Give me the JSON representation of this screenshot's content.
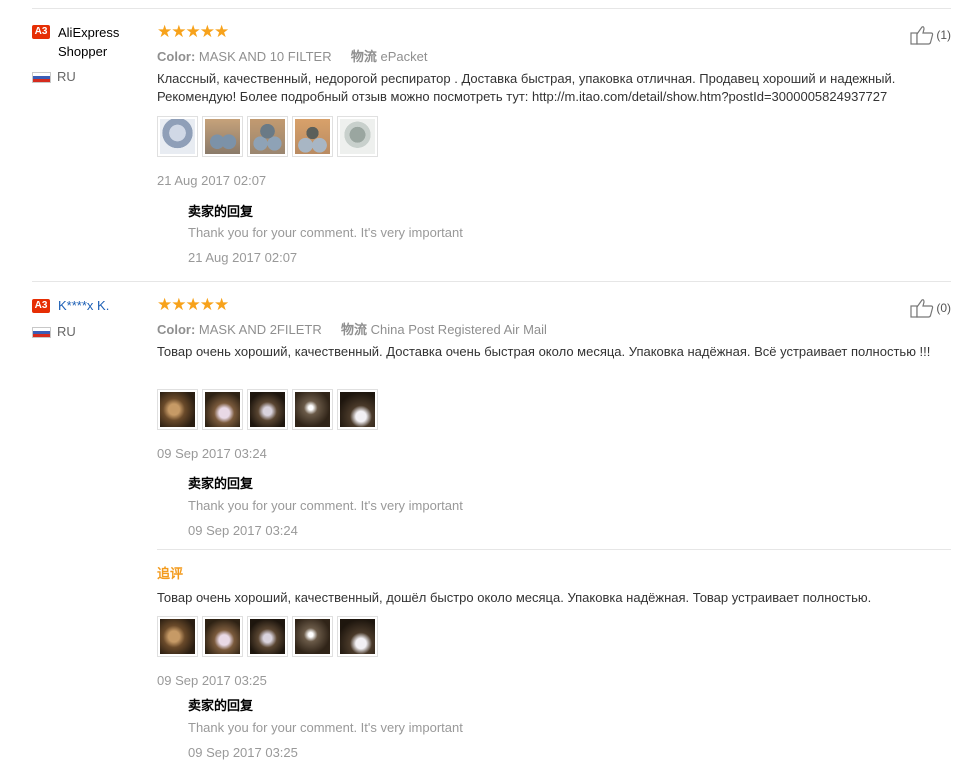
{
  "reviews": [
    {
      "badge": "A3",
      "user": "AliExpress Shopper",
      "country": "RU",
      "stars": "★★★★★",
      "color_label": "Color:",
      "color_value": "MASK AND 10 FILTER",
      "shipping_label": "物流",
      "shipping_value": "ePacket",
      "likes": "(1)",
      "text": "Классный, качественный, недорогой респиратор . Доставка быстрая, упаковка отличная. Продавец хороший и надежный. Рекомендую! Более подробный отзыв можно посмотреть тут: http://m.itao.com/detail/show.htm?postId=3000005824937727",
      "date": "21 Aug 2017 02:07",
      "reply_title": "卖家的回复",
      "reply_text": "Thank you for your comment. It's very important",
      "reply_date": "21 Aug 2017 02:07"
    },
    {
      "badge": "A3",
      "user": "K****x K.",
      "country": "RU",
      "stars": "★★★★★",
      "color_label": "Color:",
      "color_value": "MASK AND 2FILETR",
      "shipping_label": "物流",
      "shipping_value": "China Post Registered Air Mail",
      "likes": "(0)",
      "text": "Товар очень хороший, качественный. Доставка очень быстрая около месяца. Упаковка надёжная. Всё устраивает полностью !!!",
      "date": "09 Sep 2017 03:24",
      "reply_title": "卖家的回复",
      "reply_text": "Thank you for your comment. It's very important",
      "reply_date": "09 Sep 2017 03:24",
      "followup": {
        "label": "追评",
        "text": "Товар очень хороший, качественный, дошёл быстро около месяца. Упаковка надёжная. Товар устраивает полностью.",
        "date": "09 Sep 2017 03:25",
        "reply_title": "卖家的回复",
        "reply_text": "Thank you for your comment. It's very important",
        "reply_date": "09 Sep 2017 03:25"
      }
    }
  ],
  "colors": {
    "stars": "#f7a21b",
    "badge": "#e62e04",
    "link": "#1c5fb5",
    "followup": "#f39b1d"
  },
  "icons": {
    "like": "thumbs-up-icon",
    "flag": "russia-flag-icon"
  }
}
